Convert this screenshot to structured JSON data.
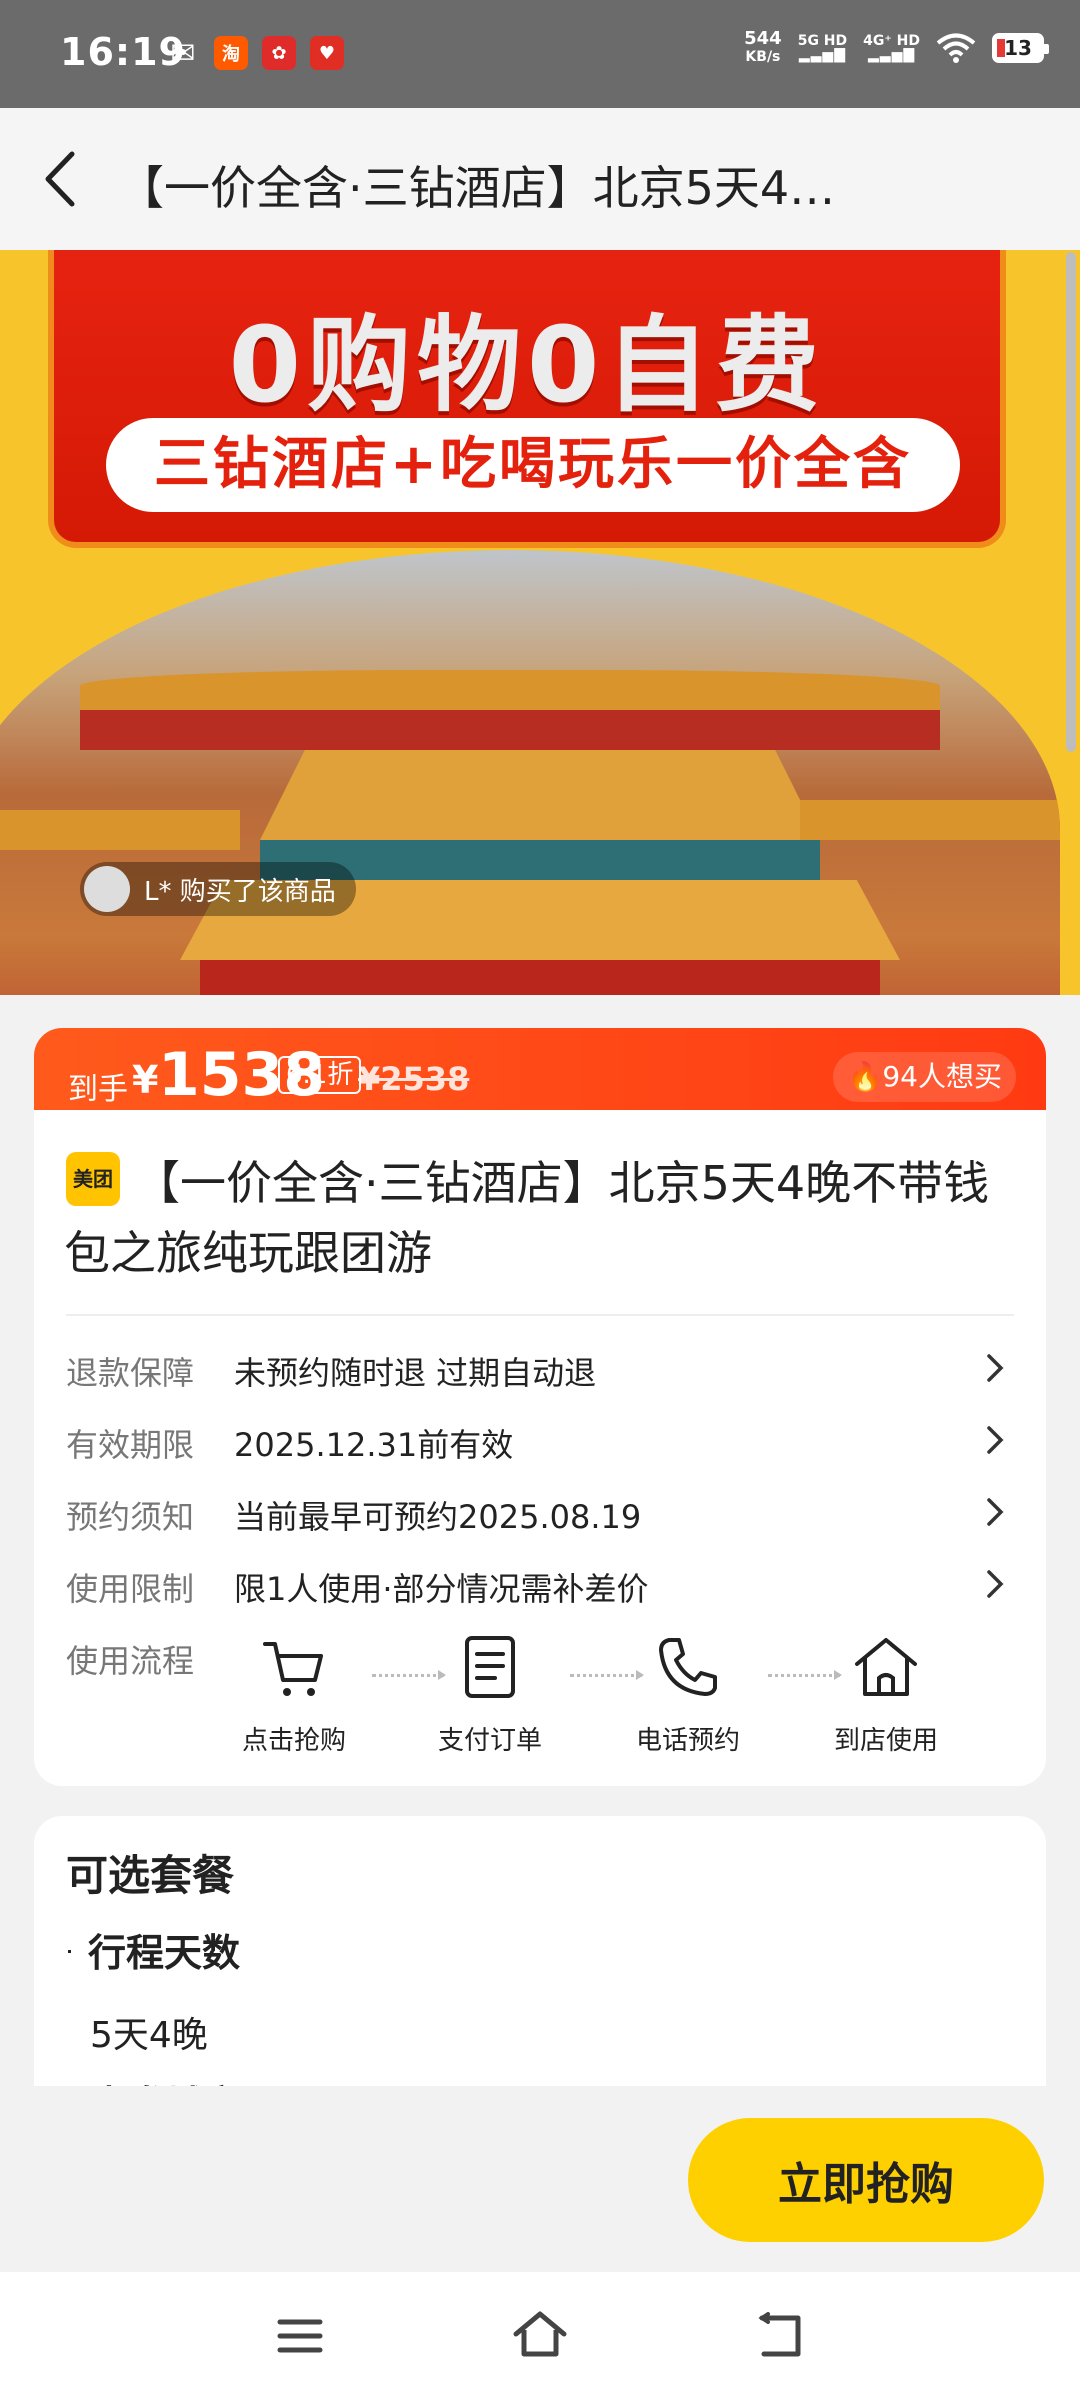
{
  "status_bar": {
    "time": "16:19",
    "speed_value": "544",
    "speed_unit": "KB/s",
    "net1": "5G HD",
    "net2": "4G⁺ HD",
    "battery": "13"
  },
  "nav": {
    "title": "【一价全含·三钻酒店】北京5天4…"
  },
  "banner": {
    "slogan": "0购物0自费",
    "pill": "三钻酒店+吃喝玩乐一价全含",
    "buyer_text": "L* 购买了该商品"
  },
  "price": {
    "label": "到手",
    "currency": "¥",
    "amount": "1538",
    "discount": "6.1折",
    "original": "¥2538",
    "want": "94人想买"
  },
  "product": {
    "badge": "美团",
    "title": "【一价全含·三钻酒店】北京5天4晚不带钱包之旅纯玩跟团游"
  },
  "info_rows": [
    {
      "key": "退款保障",
      "value": "未预约随时退 过期自动退"
    },
    {
      "key": "有效期限",
      "value": "2025.12.31前有效"
    },
    {
      "key": "预约须知",
      "value": "当前最早可预约2025.08.19"
    },
    {
      "key": "使用限制",
      "value": "限1人使用·部分情况需补差价"
    }
  ],
  "process": {
    "label": "使用流程",
    "steps": [
      "点击抢购",
      "支付订单",
      "电话预约",
      "到店使用"
    ]
  },
  "packages": {
    "heading": "可选套餐",
    "sub": "行程天数",
    "value": "5天4晚",
    "cut_label": "出发城市"
  },
  "cta": {
    "label": "立即抢购"
  },
  "colors": {
    "accent_yellow": "#ffd000",
    "price_red": "#ff4a16"
  }
}
